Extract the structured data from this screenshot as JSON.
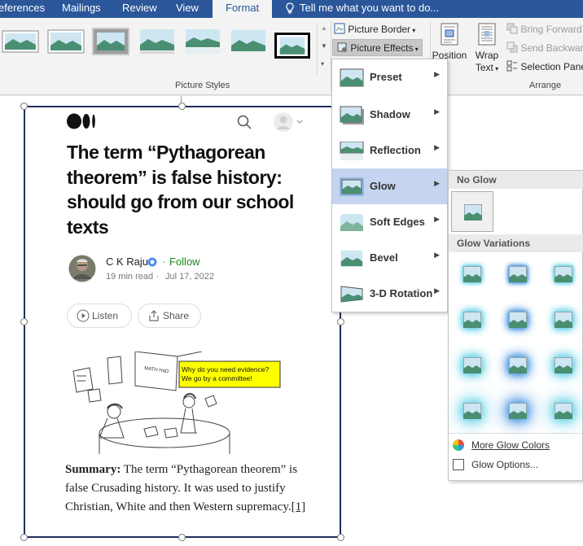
{
  "tabs": [
    "eferences",
    "Mailings",
    "Review",
    "View",
    "Format"
  ],
  "tell_me": "Tell me what you want to do...",
  "ribbon": {
    "picture_border": "Picture Border",
    "picture_effects": "Picture Effects",
    "picture_styles_label": "Picture Styles",
    "position": "Position",
    "wrap_text": "Wrap Text",
    "bring_forward": "Bring Forward",
    "send_backward": "Send Backward",
    "selection_pane": "Selection Pane",
    "arrange_label": "Arrange"
  },
  "effects_menu": {
    "items": [
      "Preset",
      "Shadow",
      "Reflection",
      "Glow",
      "Soft Edges",
      "Bevel",
      "3-D Rotation"
    ],
    "highlighted": "Glow"
  },
  "glow_menu": {
    "no_glow": "No Glow",
    "variations": "Glow Variations",
    "more_colors": "More Glow Colors",
    "options": "Glow Options..."
  },
  "article": {
    "title": "The term “Pythagorean theorem” is false history: should go from our school texts",
    "author": "C K Raju",
    "follow": "Follow",
    "read_time": "19 min read",
    "date": "Jul 17, 2022",
    "listen": "Listen",
    "share": "Share",
    "bubble_line1": "Why do you need evidence?",
    "bubble_line2": "We go by a committee!",
    "board_text": "MATH HaD",
    "summary_label": "Summary:",
    "summary_text": " The term “Pythagorean theorem” is false Crusading history. It was used to justify Christian, White and then Western supremacy.",
    "footnote": "[1]"
  },
  "colors": {
    "tab_blue": "#2b579a",
    "highlight": "#c5d5ef",
    "glow": "#5ccfe6",
    "follow_green": "#1a8917"
  }
}
